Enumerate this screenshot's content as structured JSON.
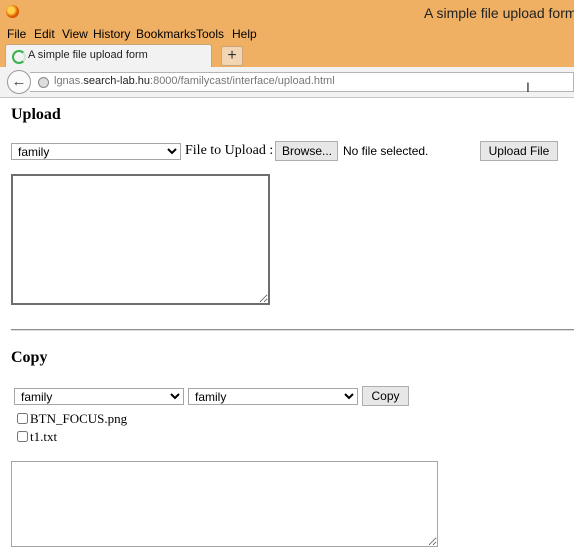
{
  "window": {
    "title": "A simple file upload form -",
    "menu": [
      "File",
      "Edit",
      "View",
      "History",
      "Bookmarks",
      "Tools",
      "Help"
    ]
  },
  "tab": {
    "label": "A simple file upload form",
    "new_tab": "+"
  },
  "address": {
    "prefix": "lgnas.",
    "host": "search-lab.hu",
    "path": ":8000/familycast/interface/upload.html"
  },
  "upload": {
    "heading": "Upload",
    "select_value": "family",
    "file_label": "File to Upload :",
    "browse_label": "Browse...",
    "no_file_text": "No file selected.",
    "upload_button": "Upload File"
  },
  "copy": {
    "heading": "Copy",
    "source_value": "family",
    "target_value": "family",
    "copy_button": "Copy",
    "files": [
      "BTN_FOCUS.png",
      "t1.txt"
    ]
  }
}
